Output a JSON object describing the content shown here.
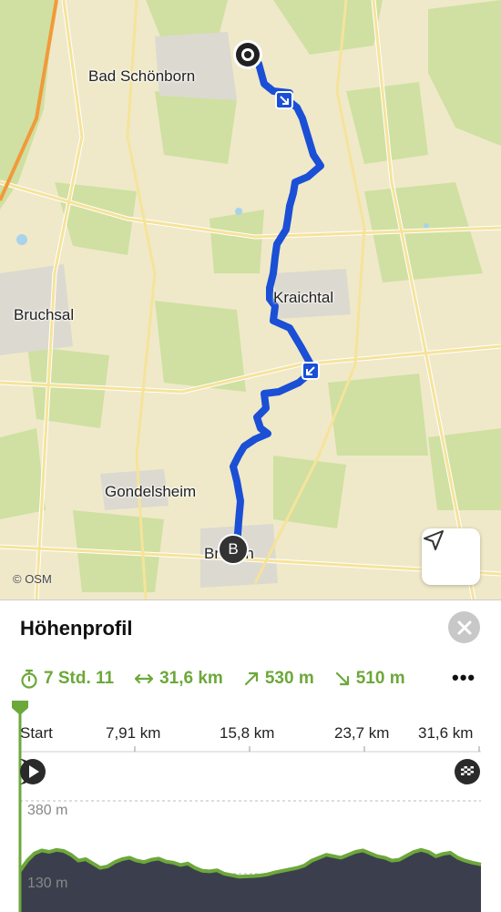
{
  "map": {
    "places": [
      {
        "name": "Bad Schönborn"
      },
      {
        "name": "Kraichtal"
      },
      {
        "name": "Bruchsal"
      },
      {
        "name": "Gondelsheim"
      },
      {
        "name": "Bretten"
      }
    ],
    "attribution": "© OSM",
    "end_marker": "B"
  },
  "panel": {
    "title": "Höhenprofil",
    "stats": {
      "duration": "7 Std. 11",
      "distance": "31,6 km",
      "ascent": "530 m",
      "descent": "510 m"
    },
    "more": "•••",
    "axis_ticks": [
      "Start",
      "7,91 km",
      "15,8 km",
      "23,7 km",
      "31,6 km"
    ],
    "elevation_labels": [
      "380 m",
      "130 m"
    ]
  },
  "colors": {
    "route": "#1a4fd6",
    "accent_green": "#6ca83a",
    "profile_fill": "#3b3f4d"
  },
  "chart_data": {
    "type": "area",
    "title": "Höhenprofil",
    "xlabel": "",
    "ylabel": "",
    "x_unit": "km",
    "xlim": [
      0,
      31.6
    ],
    "x_ticks": [
      "Start",
      "7,91 km",
      "15,8 km",
      "23,7 km",
      "31,6 km"
    ],
    "y_ticks": [
      "380 m",
      "130 m"
    ],
    "x": [
      0,
      0.5,
      1,
      1.5,
      2,
      2.5,
      3,
      3.5,
      4,
      4.5,
      5,
      5.5,
      6,
      6.5,
      7,
      7.5,
      8,
      8.5,
      9,
      9.5,
      10,
      10.5,
      11,
      11.5,
      12,
      12.5,
      13,
      13.5,
      14,
      14.5,
      15,
      15.5,
      16,
      16.5,
      17,
      17.5,
      18,
      18.5,
      19,
      19.5,
      20,
      20.5,
      21,
      21.5,
      22,
      22.5,
      23,
      23.5,
      24,
      24.5,
      25,
      25.5,
      26,
      26.5,
      27,
      27.5,
      28,
      28.5,
      29,
      29.5,
      30,
      30.5,
      31,
      31.6
    ],
    "y": [
      140,
      175,
      200,
      210,
      205,
      212,
      208,
      195,
      175,
      180,
      165,
      150,
      155,
      170,
      180,
      185,
      175,
      170,
      178,
      182,
      172,
      168,
      160,
      165,
      150,
      140,
      138,
      142,
      130,
      125,
      120,
      121,
      122,
      124,
      128,
      135,
      140,
      145,
      150,
      158,
      175,
      185,
      195,
      190,
      185,
      195,
      205,
      210,
      200,
      190,
      185,
      175,
      178,
      192,
      205,
      212,
      205,
      190,
      198,
      202,
      185,
      175,
      168,
      162
    ]
  }
}
